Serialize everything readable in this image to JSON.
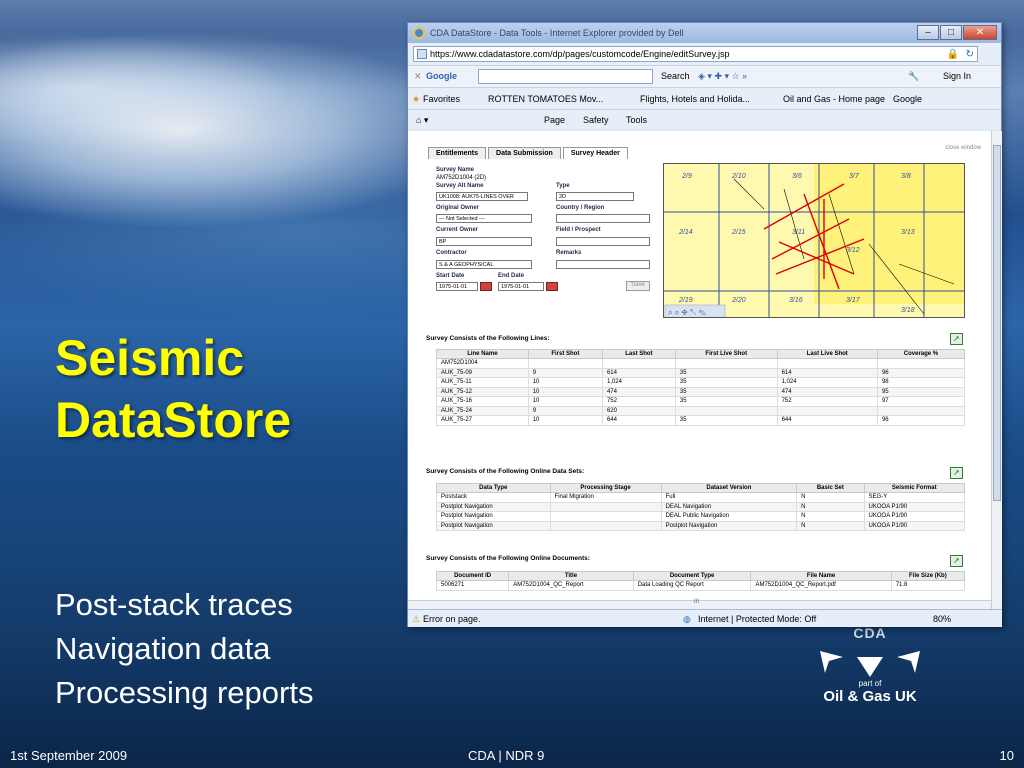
{
  "slide": {
    "title_line1": "Seismic",
    "title_line2": "DataStore",
    "bullets": [
      "Post-stack traces",
      "Navigation data",
      "Processing reports"
    ],
    "footer_left": "1st September 2009",
    "footer_center": "CDA | NDR 9",
    "footer_right": "10",
    "logo": {
      "mark": "CDA",
      "part_of": "part of",
      "org": "Oil & Gas UK"
    }
  },
  "browser": {
    "window_title": "CDA DataStore - Data Tools - Internet Explorer provided by Dell",
    "url": "https://www.cdadatastore.com/dp/pages/customcode/Engine/editSurvey.jsp",
    "google_label": "Google",
    "google_search": "Search",
    "sign_in": "Sign In",
    "favorites": "Favorites",
    "fav_items": [
      "ROTTEN TOMATOES Mov...",
      "Flights, Hotels and Holida...",
      "Oil and Gas - Home page",
      "Google"
    ],
    "cmd_items": [
      "Page",
      "Safety",
      "Tools"
    ],
    "status_error": "Error on page.",
    "status_zone": "Internet | Protected Mode: Off",
    "zoom": "80%",
    "hscroll_marker": "III"
  },
  "page": {
    "tabs": [
      "Entitlements",
      "Data Submission",
      "Survey Header"
    ],
    "close_window": "close window",
    "form": {
      "survey_name_label": "Survey Name",
      "survey_name_value": "AM752D1004 (2D)",
      "survey_alt_label": "Survey Alt Name",
      "survey_alt_value": "UK1008: AUK75-LINES OVER",
      "type_label": "Type",
      "type_value": "2D",
      "orig_owner_label": "Original Owner",
      "orig_owner_value": "--- Not Selected ---",
      "country_label": "Country / Region",
      "cur_owner_label": "Current Owner",
      "cur_owner_value": "BP",
      "field_label": "Field / Prospect",
      "contractor_label": "Contractor",
      "contractor_value": "S & A GEOPHYSICAL",
      "remarks_label": "Remarks",
      "start_label": "Start Date",
      "start_value": "1975-01-01",
      "end_label": "End Date",
      "end_value": "1975-01-01",
      "save_label": "Save"
    },
    "map_blocks": [
      "2/9",
      "2/10",
      "3/6",
      "3/7",
      "3/8",
      "2/14",
      "2/15",
      "3/11",
      "3/12",
      "3/13",
      "2/19",
      "2/20",
      "3/16",
      "3/17",
      "3/18"
    ],
    "lines_title": "Survey Consists of the Following Lines:",
    "lines_columns": [
      "Line Name",
      "First Shot",
      "Last Shot",
      "First Live Shot",
      "Last Live Shot",
      "Coverage %"
    ],
    "lines_rows": [
      [
        "AM752D1004",
        "",
        "",
        "",
        "",
        ""
      ],
      [
        "AUK_75-09",
        "9",
        "614",
        "35",
        "614",
        "96"
      ],
      [
        "AUK_75-11",
        "10",
        "1,024",
        "35",
        "1,024",
        "98"
      ],
      [
        "AUK_75-12",
        "10",
        "474",
        "35",
        "474",
        "95"
      ],
      [
        "AUK_75-16",
        "10",
        "752",
        "35",
        "752",
        "97"
      ],
      [
        "AUK_75-24",
        "9",
        "620",
        "",
        "",
        ""
      ],
      [
        "AUK_75-27",
        "10",
        "644",
        "35",
        "644",
        "96"
      ]
    ],
    "datasets_title": "Survey Consists of the Following Online Data Sets:",
    "datasets_columns": [
      "Data Type",
      "Processing Stage",
      "Dataset Version",
      "Basic Set",
      "Seismic Format"
    ],
    "datasets_rows": [
      [
        "Poststack",
        "Final Migration",
        "Full",
        "N",
        "SEG-Y"
      ],
      [
        "Postplot Navigation",
        "",
        "DEAL Navigation",
        "N",
        "UKOOA P1/90"
      ],
      [
        "Postplot Navigation",
        "",
        "DEAL Public Navigation",
        "N",
        "UKOOA P1/90"
      ],
      [
        "Postplot Navigation",
        "",
        "Postplot Navigation",
        "N",
        "UKOOA P1/90"
      ]
    ],
    "docs_title": "Survey Consists of the Following Online Documents:",
    "docs_columns": [
      "Document ID",
      "Title",
      "Document Type",
      "File Name",
      "File Size (Kb)"
    ],
    "docs_rows": [
      [
        "5006271",
        "AM752D1004_QC_Report",
        "Data Loading QC Report",
        "AM752D1004_QC_Report.pdf",
        "71.8"
      ]
    ]
  }
}
